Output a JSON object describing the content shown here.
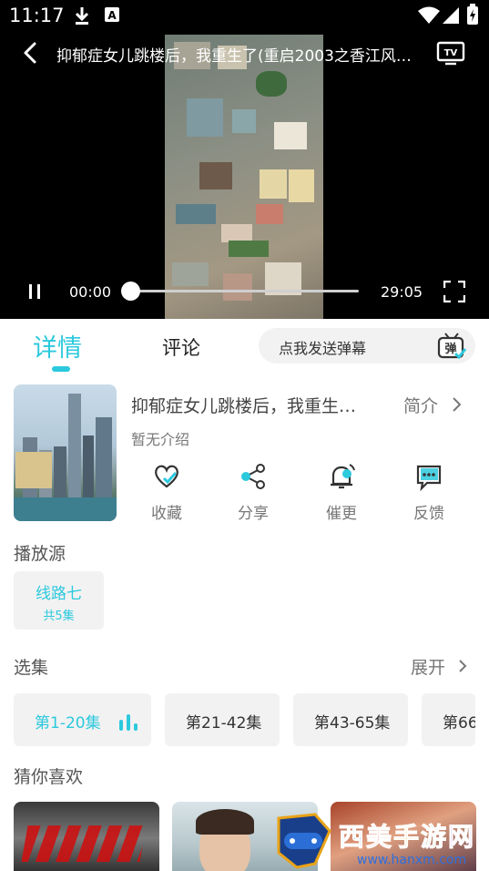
{
  "status_bar": {
    "time": "11:17",
    "icons": [
      "download-icon",
      "a-notification-icon",
      "wifi-icon",
      "signal-icon",
      "battery-charging-icon"
    ]
  },
  "player": {
    "title": "抑郁症女儿跳楼后，我重生了(重启2003之香江风…",
    "current_time": "00:00",
    "duration": "29:05",
    "progress": 0,
    "state": "playing",
    "icons": {
      "back": "back-arrow-icon",
      "cast": "tv-cast-icon",
      "pause": "pause-icon",
      "fullscreen": "fullscreen-icon"
    }
  },
  "tabs": {
    "detail": "详情",
    "comment": "评论",
    "active": "detail",
    "danmu_placeholder": "点我发送弹幕",
    "danmu_icon": "danmu-tv-icon"
  },
  "info": {
    "title": "抑郁症女儿跳楼后，我重生…",
    "intro_link": "简介",
    "no_intro": "暂无介绍",
    "actions": [
      {
        "label": "收藏",
        "icon": "heart-icon"
      },
      {
        "label": "分享",
        "icon": "share-icon"
      },
      {
        "label": "催更",
        "icon": "bell-icon"
      },
      {
        "label": "反馈",
        "icon": "feedback-icon"
      }
    ]
  },
  "source": {
    "heading": "播放源",
    "name": "线路七",
    "count": "共5集"
  },
  "episodes": {
    "heading": "选集",
    "expand": "展开",
    "ranges": [
      "第1-20集",
      "第21-42集",
      "第43-65集",
      "第66"
    ],
    "active_index": 0
  },
  "recommend": {
    "heading": "猜你喜欢"
  },
  "colors": {
    "accent": "#2cc9dd",
    "chip_bg": "#f2f2f2",
    "text_muted": "#777777"
  }
}
